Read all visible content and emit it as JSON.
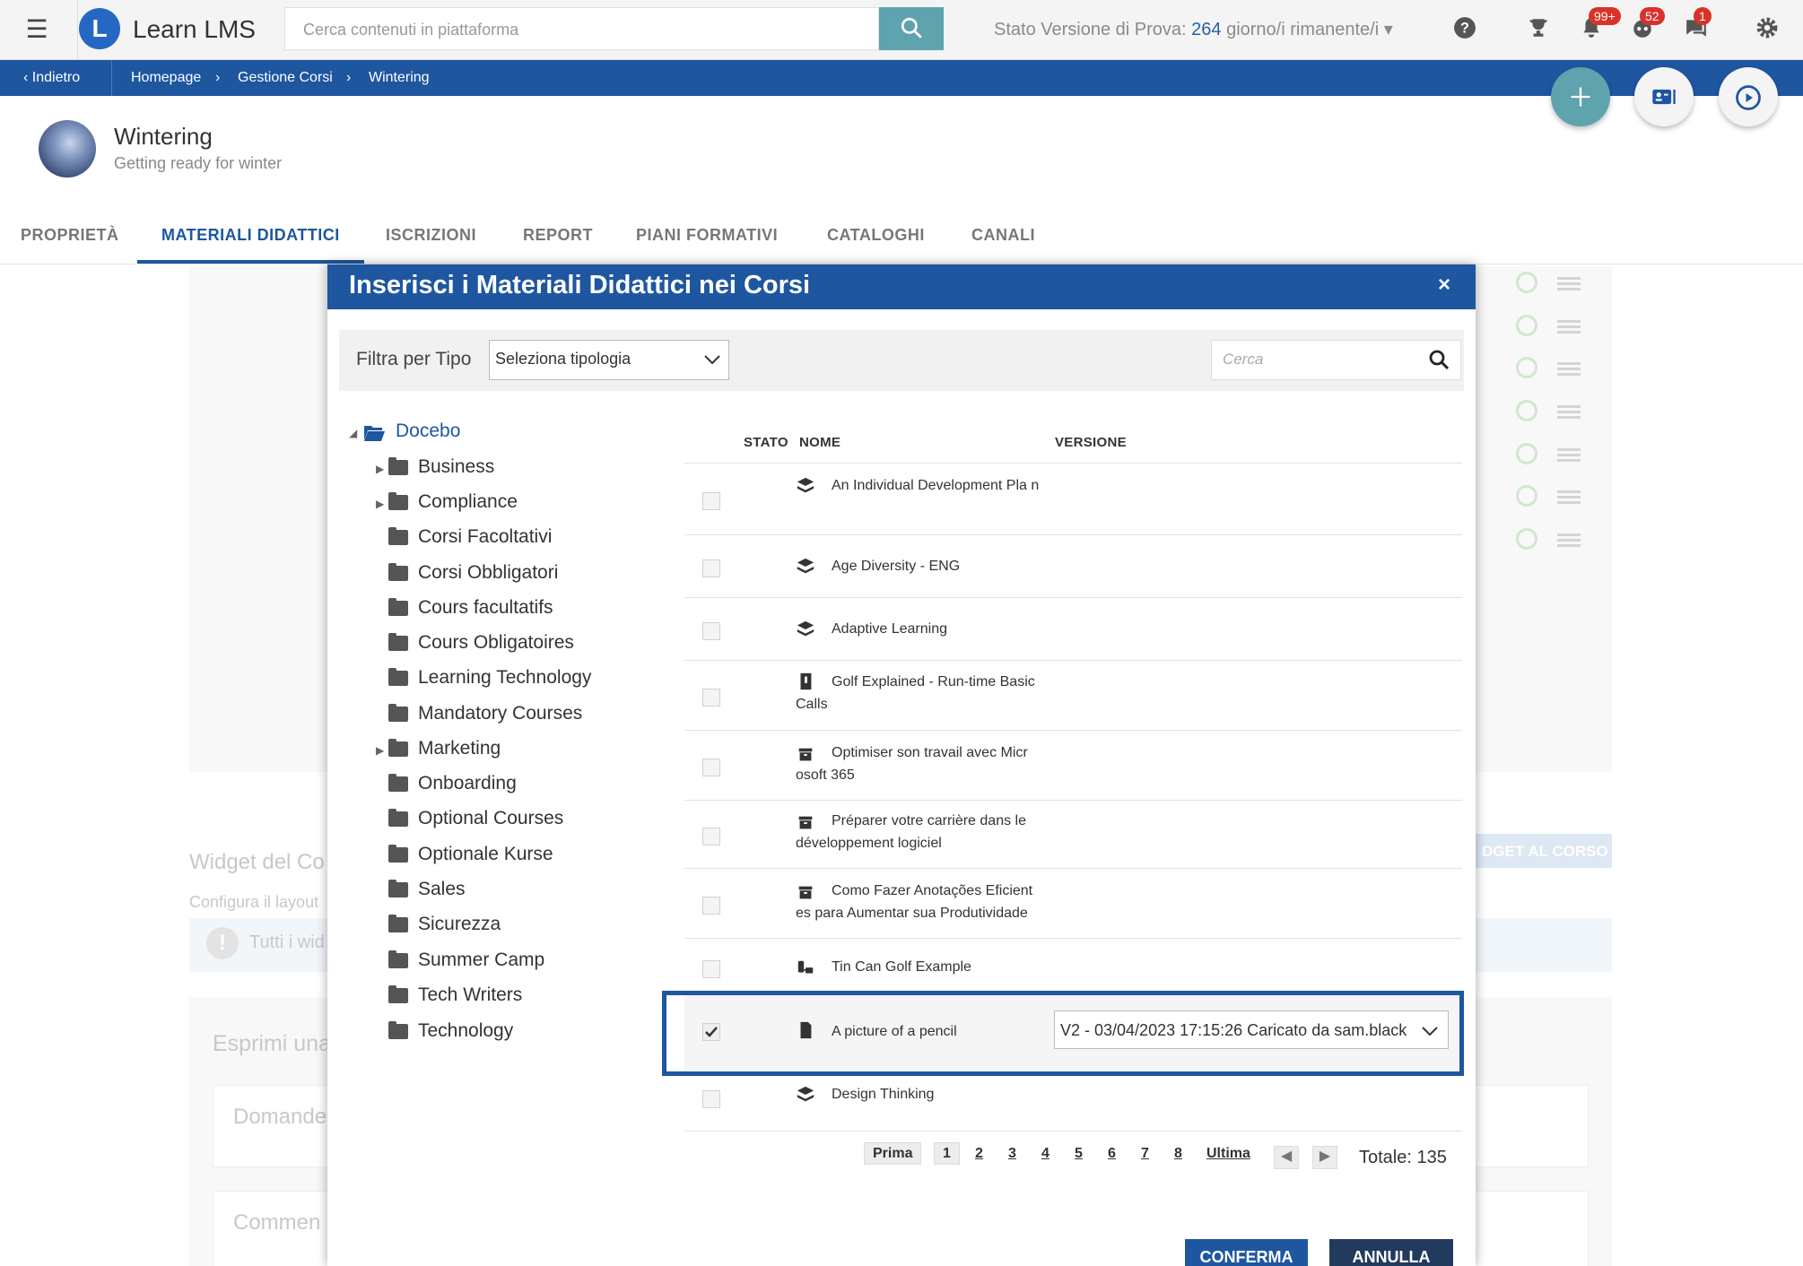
{
  "topbar": {
    "app_name": "Learn LMS",
    "logo_letter": "L",
    "search_placeholder": "Cerca contenuti in piattaforma",
    "trial_prefix": "Stato Versione di Prova:",
    "trial_days": "264",
    "trial_suffix": "giorno/i rimanente/i",
    "badges": {
      "notifications": "99+",
      "messages": "52",
      "chat": "1"
    }
  },
  "breadcrumb": {
    "back": "Indietro",
    "items": [
      "Homepage",
      "Gestione Corsi",
      "Wintering"
    ]
  },
  "course": {
    "title": "Wintering",
    "subtitle": "Getting ready for winter"
  },
  "tabs": [
    "PROPRIETÀ",
    "MATERIALI DIDATTICI",
    "ISCRIZIONI",
    "REPORT",
    "PIANI FORMATIVI",
    "CATALOGHI",
    "CANALI"
  ],
  "background": {
    "widget_title": "Widget del Co",
    "widget_desc": "Configura il layout",
    "widget_button": "DGET AL CORSO",
    "widget_info": "Tutti i wid",
    "express": "Esprimi una",
    "questions": "Domande",
    "comments": "Commen"
  },
  "modal": {
    "title": "Inserisci i Materiali Didattici nei Corsi",
    "close": "×",
    "filter_label": "Filtra per Tipo",
    "filter_value": "Seleziona tipologia",
    "search_placeholder": "Cerca",
    "tree": {
      "root": "Docebo",
      "folders": [
        "Business",
        "Compliance",
        "Corsi Facoltativi",
        "Corsi Obbligatori",
        "Cours facultatifs",
        "Cours Obligatoires",
        "Learning Technology",
        "Mandatory Courses",
        "Marketing",
        "Onboarding",
        "Optional Courses",
        "Optionale Kurse",
        "Sales",
        "Sicurezza",
        "Summer Camp",
        "Tech Writers",
        "Technology"
      ]
    },
    "columns": {
      "status": "STATO",
      "name": "NOME",
      "version": "VERSIONE"
    },
    "rows": [
      {
        "name": "An Individual Development Pla n",
        "icon": "layers-icon"
      },
      {
        "name": "Age Diversity - ENG",
        "icon": "layers-icon"
      },
      {
        "name": "Adaptive Learning",
        "icon": "layers-icon"
      },
      {
        "name": "Golf Explained - Run-time Basic Calls",
        "icon": "package-icon"
      },
      {
        "name": "Optimiser son travail avec Micr osoft 365",
        "icon": "archive-icon"
      },
      {
        "name": "Préparer votre carrière dans le développement logiciel",
        "icon": "archive-icon"
      },
      {
        "name": "Como Fazer Anotações Eficient es para Aumentar sua Produtividade",
        "icon": "archive-icon"
      },
      {
        "name": "Tin Can Golf Example",
        "icon": "tincan-icon"
      },
      {
        "name": "A picture of a pencil",
        "icon": "file-icon",
        "version": "V2 - 03/04/2023 17:15:26 Caricato da sam.black"
      },
      {
        "name": "Design Thinking",
        "icon": "layers-icon"
      }
    ],
    "pagination": {
      "first": "Prima",
      "pages": [
        "1",
        "2",
        "3",
        "4",
        "5",
        "6",
        "7",
        "8"
      ],
      "last": "Ultima",
      "total_label": "Totale:",
      "total": "135"
    },
    "confirm": "CONFERMA",
    "cancel": "ANNULLA"
  },
  "colors": {
    "primary": "#1e56a0",
    "search_button": "#5ea3ad",
    "fab_green": "#5ea3ad",
    "badge": "#d9322b"
  }
}
